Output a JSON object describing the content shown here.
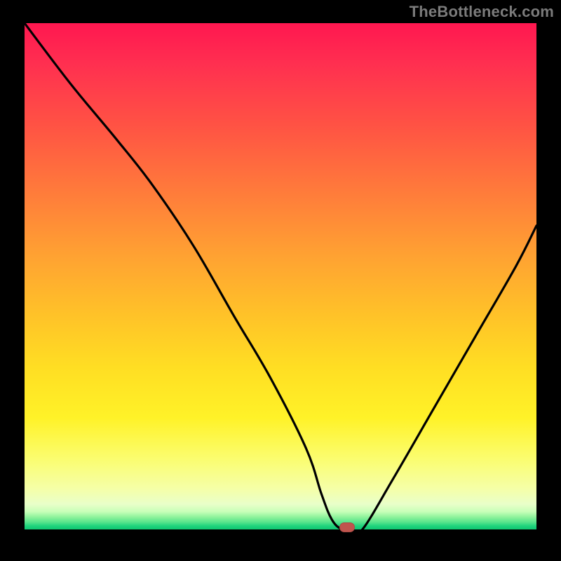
{
  "attribution": "TheBottleneck.com",
  "chart_data": {
    "type": "line",
    "title": "",
    "xlabel": "",
    "ylabel": "",
    "xlim": [
      0,
      100
    ],
    "ylim": [
      0,
      100
    ],
    "series": [
      {
        "name": "bottleneck-curve",
        "x": [
          0,
          9,
          18,
          25,
          33,
          41,
          48,
          55,
          58,
          60,
          62,
          64,
          66,
          72,
          80,
          88,
          96,
          100
        ],
        "values": [
          100,
          88,
          77,
          68,
          56,
          42,
          30,
          16,
          7,
          2,
          0,
          0,
          0,
          10,
          24,
          38,
          52,
          60
        ]
      }
    ],
    "marker": {
      "x": 63,
      "y": 0,
      "label": "optimal-point"
    },
    "background_gradient": {
      "top_color": "#ff1750",
      "mid_color": "#ffde23",
      "bottom_color": "#0fc471"
    }
  }
}
